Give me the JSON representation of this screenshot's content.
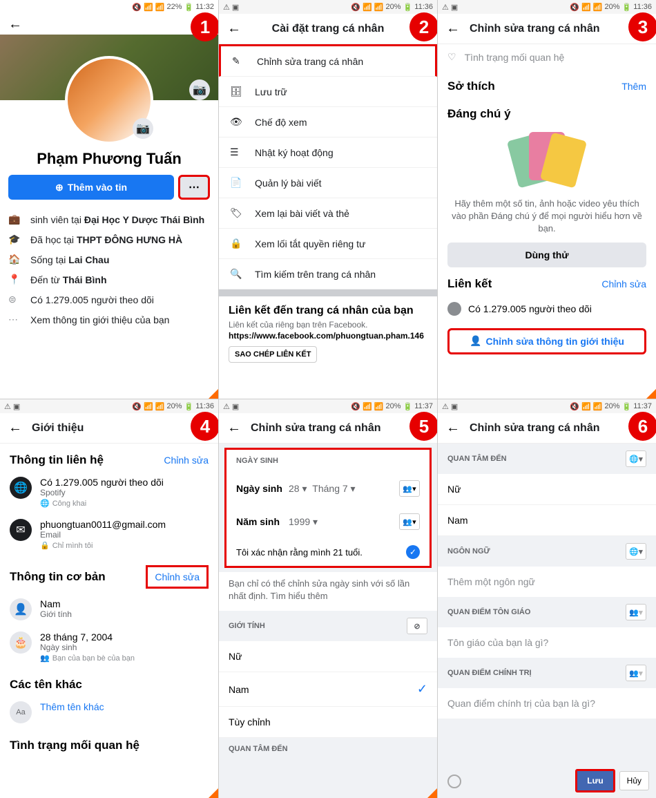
{
  "p1": {
    "status": {
      "battery": "22%",
      "time": "11:32"
    },
    "name": "Phạm Phương Tuấn",
    "add_story": "Thêm vào tin",
    "more": "⋯",
    "info": {
      "student": "sinh viên tại ",
      "uni": "Đại Học Y Dược Thái Bình",
      "studied": "Đã học tại ",
      "school": "THPT ĐÔNG HƯNG HÀ",
      "lives": "Sống tại ",
      "city": "Lai Chau",
      "from": "Đến từ ",
      "hometown": "Thái Bình",
      "followers": "Có 1.279.005 người theo dõi",
      "see_intro": "Xem thông tin giới thiệu của bạn"
    }
  },
  "p2": {
    "status": {
      "battery": "20%",
      "time": "11:36"
    },
    "title": "Cài đặt trang cá nhân",
    "menu": {
      "edit": "Chỉnh sửa trang cá nhân",
      "archive": "Lưu trữ",
      "view": "Chế độ xem",
      "activity": "Nhật ký hoạt động",
      "manage": "Quản lý bài viết",
      "review": "Xem lại bài viết và thẻ",
      "privacy": "Xem lối tắt quyền riêng tư",
      "search": "Tìm kiếm trên trang cá nhân"
    },
    "link": {
      "heading": "Liên kết đến trang cá nhân của bạn",
      "sub": "Liên kết của riêng bạn trên Facebook.",
      "url": "https://www.facebook.com/phuongtuan.pham.146",
      "copy": "SAO CHÉP LIÊN KẾT"
    }
  },
  "p3": {
    "status": {
      "battery": "20%",
      "time": "11:36"
    },
    "title": "Chỉnh sửa trang cá nhân",
    "rel": "Tình trạng mối quan hệ",
    "hobbies": "Sở thích",
    "add": "Thêm",
    "notable": "Đáng chú ý",
    "feat_text": "Hãy thêm một số tin, ảnh hoặc video yêu thích vào phần Đáng chú ý để mọi người hiểu hơn về bạn.",
    "try": "Dùng thử",
    "links": "Liên kết",
    "edit": "Chỉnh sửa",
    "followers": "Có 1.279.005 người theo dõi",
    "edit_intro": "Chỉnh sửa thông tin giới thiệu"
  },
  "p4": {
    "status": {
      "battery": "20%",
      "time": "11:36"
    },
    "title": "Giới thiệu",
    "contact": "Thông tin liên hệ",
    "edit": "Chỉnh sửa",
    "followers": "Có 1.279.005 người theo dõi",
    "spotify": "Spotify",
    "public": "Công khai",
    "email": "phuongtuan0011@gmail.com",
    "email_lbl": "Email",
    "only_me": "Chỉ mình tôi",
    "basic": "Thông tin cơ bản",
    "gender": "Nam",
    "gender_lbl": "Giới tính",
    "dob": "28 tháng 7, 2004",
    "dob_lbl": "Ngày sinh",
    "fof": "Bạn của bạn bè của bạn",
    "other_names": "Các tên khác",
    "add_name": "Thêm tên khác",
    "rel": "Tình trạng mối quan hệ"
  },
  "p5": {
    "status": {
      "battery": "20%",
      "time": "11:37"
    },
    "title": "Chỉnh sửa trang cá nhân",
    "dob_section": "NGÀY SINH",
    "dob_lbl": "Ngày sinh",
    "day": "28",
    "month": "Tháng 7",
    "year_lbl": "Năm sinh",
    "year": "1999",
    "confirm": "Tôi xác nhận rằng mình 21 tuổi.",
    "note": "Bạn chỉ có thể chỉnh sửa ngày sinh với số lần nhất định. Tìm hiểu thêm",
    "gender_section": "GIỚI TÍNH",
    "female": "Nữ",
    "male": "Nam",
    "custom": "Tùy chỉnh",
    "interested": "QUAN TÂM ĐẾN"
  },
  "p6": {
    "status": {
      "battery": "20%",
      "time": "11:37"
    },
    "title": "Chỉnh sửa trang cá nhân",
    "interested": "QUAN TÂM ĐẾN",
    "female": "Nữ",
    "male": "Nam",
    "lang": "NGÔN NGỮ",
    "lang_ph": "Thêm một ngôn ngữ",
    "religion": "QUAN ĐIỂM TÔN GIÁO",
    "religion_ph": "Tôn giáo của bạn là gì?",
    "politics": "QUAN ĐIỂM CHÍNH TRỊ",
    "politics_ph": "Quan điểm chính trị của bạn là gì?",
    "save": "Lưu",
    "cancel": "Hủy"
  }
}
